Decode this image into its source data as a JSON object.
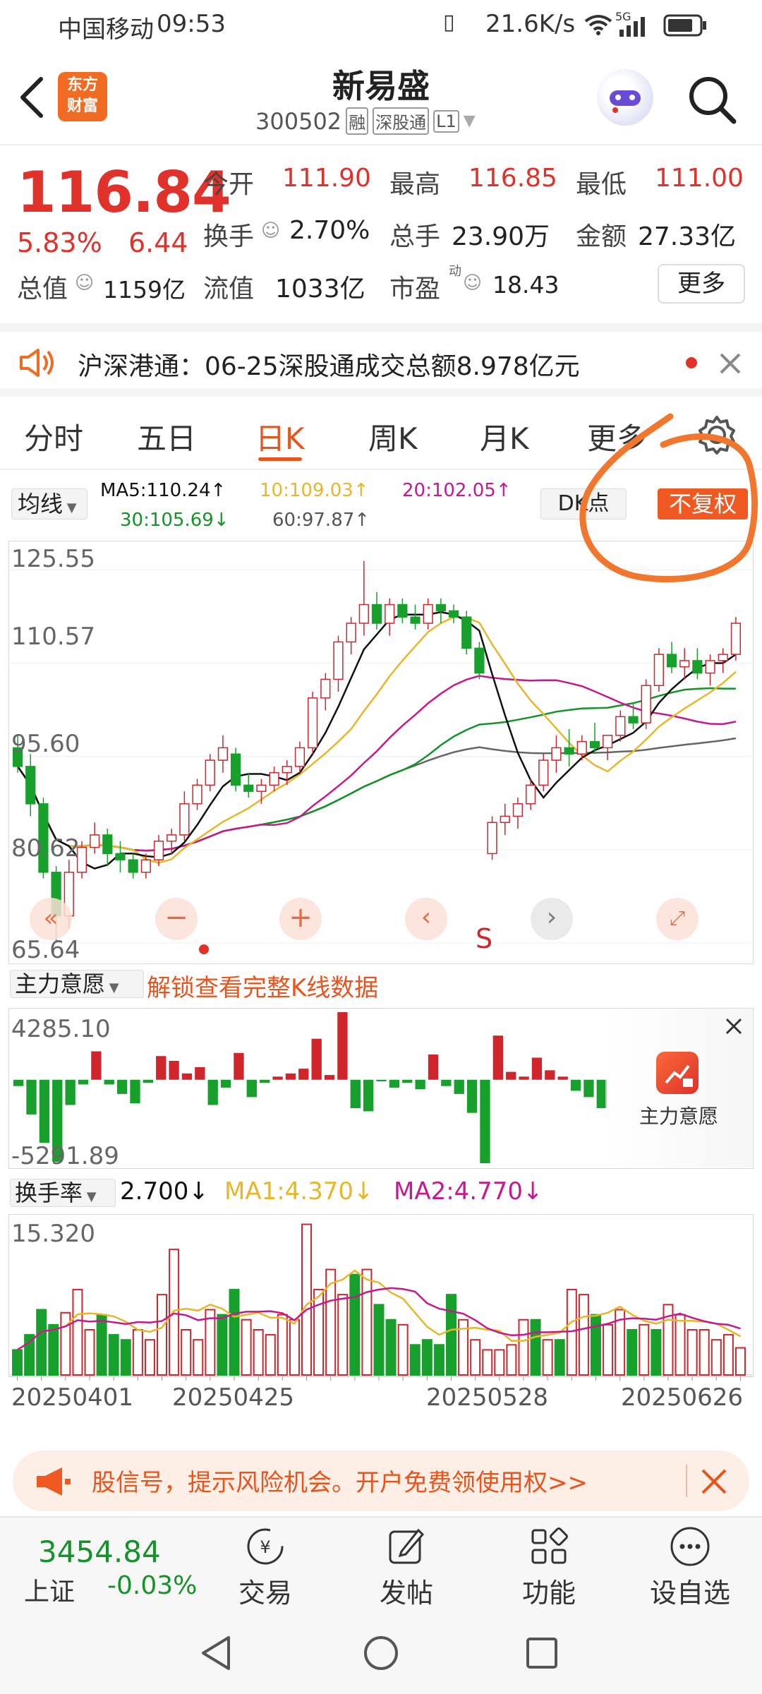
{
  "status": {
    "carrier": "中国移动",
    "time": "09:53",
    "net_speed": "21.6K/s",
    "signal_label": "5G"
  },
  "header": {
    "title": "新易盛",
    "code": "300502",
    "tags": [
      "融",
      "深股通",
      "L1"
    ],
    "logo_line1": "东方",
    "logo_line2": "财富"
  },
  "quote": {
    "price": "116.84",
    "change_pct": "5.83%",
    "change": "6.44",
    "open_label": "今开",
    "open": "111.90",
    "high_label": "最高",
    "high": "116.85",
    "low_label": "最低",
    "low": "111.00",
    "turnover_label": "换手",
    "turnover": "2.70%",
    "volume_label": "总手",
    "volume": "23.90万",
    "amount_label": "金额",
    "amount": "27.33亿",
    "mcap_label": "总值",
    "mcap": "1159亿",
    "float_label": "流值",
    "float": "1033亿",
    "pe_label": "市盈",
    "pe_super": "动",
    "pe": "18.43",
    "more_button": "更多"
  },
  "notice": {
    "text": "沪深港通：06-25深股通成交总额8.978亿元"
  },
  "tabs": [
    "分时",
    "五日",
    "日K",
    "周K",
    "月K",
    "更多"
  ],
  "active_tab": 2,
  "kline": {
    "indicator_select": "均线",
    "ma5": "MA5:110.24↑",
    "ma10": "10:109.03↑",
    "ma20": "20:102.05↑",
    "ma30": "30:105.69↓",
    "ma60": "60:97.87↑",
    "dk_button": "DK点",
    "adjust_button": "不复权",
    "y_labels": [
      "125.55",
      "110.57",
      "95.60",
      "80.62",
      "65.64"
    ],
    "s_marker": "S",
    "colors": {
      "ma5": "#111111",
      "ma10": "#e8b62a",
      "ma20": "#c4198f",
      "ma30": "#17922b",
      "ma60": "#666666",
      "up": "#d0262b",
      "down": "#17a12c"
    }
  },
  "chart_data": [
    {
      "type": "candlestick",
      "title": "",
      "y_axis_ticks": [
        125.55,
        110.57,
        95.6,
        80.62,
        65.64
      ],
      "ylim": [
        65.64,
        128
      ],
      "x_date_ticks": [
        "20250401",
        "20250425",
        "20250528",
        "20250626"
      ],
      "ohlc": [
        [
          97,
          99,
          93,
          94
        ],
        [
          94,
          96,
          86,
          88
        ],
        [
          88,
          89,
          76,
          77
        ],
        [
          77,
          78,
          66,
          70
        ],
        [
          70,
          79,
          68,
          77
        ],
        [
          77,
          82,
          76,
          81
        ],
        [
          81,
          85,
          80,
          83
        ],
        [
          83,
          84,
          78,
          80
        ],
        [
          80,
          82,
          77,
          79
        ],
        [
          79,
          80,
          76,
          77
        ],
        [
          77,
          80,
          76,
          79
        ],
        [
          79,
          83,
          78,
          82
        ],
        [
          82,
          84,
          80,
          83
        ],
        [
          83,
          90,
          82,
          88
        ],
        [
          88,
          92,
          87,
          91
        ],
        [
          91,
          96,
          90,
          95
        ],
        [
          95,
          99,
          93,
          97
        ],
        [
          96,
          97,
          90,
          91
        ],
        [
          91,
          93,
          89,
          90
        ],
        [
          90,
          92,
          88,
          91
        ],
        [
          91,
          94,
          90,
          93
        ],
        [
          93,
          95,
          91,
          94
        ],
        [
          94,
          98,
          93,
          97
        ],
        [
          97,
          106,
          96,
          105
        ],
        [
          105,
          109,
          103,
          108
        ],
        [
          108,
          115,
          106,
          114
        ],
        [
          114,
          118,
          112,
          117
        ],
        [
          117,
          127,
          115,
          120
        ],
        [
          120,
          122,
          116,
          117
        ],
        [
          117,
          121,
          115,
          120
        ],
        [
          120,
          121,
          117,
          118
        ],
        [
          118,
          120,
          116,
          117
        ],
        [
          117,
          121,
          116,
          120
        ],
        [
          120,
          121,
          117,
          119
        ],
        [
          119,
          120,
          117,
          118
        ],
        [
          118,
          119,
          112,
          113
        ],
        [
          113,
          114,
          108,
          109
        ],
        [
          80,
          86,
          79,
          85
        ],
        [
          85,
          88,
          83,
          86
        ],
        [
          86,
          89,
          84,
          88
        ],
        [
          88,
          92,
          87,
          91
        ],
        [
          91,
          96,
          90,
          95
        ],
        [
          95,
          99,
          93,
          97
        ],
        [
          97,
          100,
          94,
          96
        ],
        [
          96,
          99,
          95,
          98
        ],
        [
          98,
          101,
          96,
          97
        ],
        [
          97,
          99,
          95,
          99
        ],
        [
          99,
          103,
          98,
          102
        ],
        [
          102,
          104,
          100,
          101
        ],
        [
          101,
          108,
          100,
          107
        ],
        [
          107,
          113,
          106,
          112
        ],
        [
          112,
          114,
          109,
          110
        ],
        [
          110,
          113,
          108,
          111
        ],
        [
          111,
          113,
          108,
          109
        ],
        [
          109,
          112,
          107,
          111
        ],
        [
          111,
          113,
          109,
          112
        ],
        [
          112,
          118,
          111,
          117
        ]
      ],
      "series": [
        {
          "name": "MA5",
          "last": 110.24
        },
        {
          "name": "10",
          "last": 109.03
        },
        {
          "name": "20",
          "last": 102.05
        },
        {
          "name": "30",
          "last": 105.69
        },
        {
          "name": "60",
          "last": 97.87
        }
      ]
    },
    {
      "type": "bar",
      "title": "主力意愿",
      "y_axis_ticks": [
        4285.1,
        -5291.89
      ],
      "values": [
        -400,
        -2200,
        -4000,
        -5200,
        -1600,
        -300,
        1800,
        -300,
        -900,
        -1500,
        -200,
        1500,
        1200,
        400,
        800,
        -1600,
        -500,
        1700,
        -1100,
        -200,
        200,
        400,
        700,
        2600,
        300,
        4285,
        -1800,
        -2000,
        -100,
        -500,
        -200,
        -600,
        1600,
        -400,
        -900,
        -2100,
        -5291,
        2800,
        500,
        200,
        1400,
        600,
        200,
        -700,
        -1100,
        -1800
      ]
    },
    {
      "type": "bar",
      "title": "换手率",
      "y_axis_ticks": [
        15.32
      ],
      "x_date_ticks": [
        "20250401",
        "20250425",
        "20250528",
        "20250626"
      ],
      "values": [
        2.5,
        4.0,
        6.5,
        5.0,
        6.2,
        8.5,
        4.5,
        6.0,
        4.0,
        3.5,
        4.5,
        3.5,
        8.0,
        12.5,
        4.5,
        3.5,
        6.5,
        6.0,
        8.5,
        5.5,
        4.5,
        4.0,
        6.0,
        5.5,
        15.0,
        8.5,
        10.5,
        8.0,
        10.0,
        10.5,
        7.0,
        5.5,
        5.0,
        3.0,
        3.5,
        3.0,
        8.0,
        5.5,
        3.5,
        2.5,
        2.5,
        3.0,
        5.5,
        5.5,
        3.5,
        3.5,
        8.5,
        8.0,
        6.0,
        5.0,
        6.5,
        4.5,
        5.0,
        4.5,
        7.0,
        6.0,
        4.5,
        4.5,
        3.5,
        4.0,
        2.7
      ],
      "ma_labels": {
        "value": "2.700↓",
        "ma1": "MA1:4.370↓",
        "ma2": "MA2:4.770↓"
      }
    }
  ],
  "flow": {
    "select": "主力意愿",
    "unlock_text": "解锁查看完整K线数据",
    "y_top": "4285.10",
    "y_bottom": "-5291.89",
    "side_label": "主力意愿"
  },
  "turnover": {
    "select": "换手率",
    "value": "2.700↓",
    "ma1": "MA1:4.370↓",
    "ma2": "MA2:4.770↓",
    "y_top": "15.320",
    "dates": [
      "20250401",
      "20250425",
      "20250528",
      "20250626"
    ]
  },
  "ad": {
    "text": "股信号，提示风险机会。开户免费领使用权>>"
  },
  "bottom": {
    "index_value": "3454.84",
    "index_name": "上证",
    "index_change": "-0.03%",
    "items": [
      "交易",
      "发帖",
      "功能",
      "设自选"
    ]
  }
}
